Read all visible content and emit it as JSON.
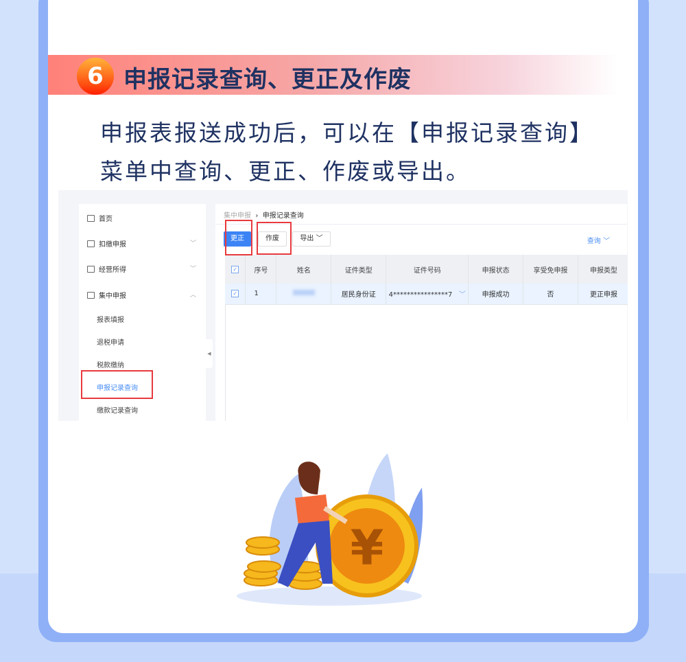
{
  "section": {
    "number": "6",
    "title": "申报记录查询、更正及作废",
    "description": "申报表报送成功后，可以在【申报记录查询】菜单中查询、更正、作废或导出。"
  },
  "sidebar": {
    "items": [
      {
        "label": "首页",
        "icon": "home-icon"
      },
      {
        "label": "扣缴申报",
        "icon": "form-icon"
      },
      {
        "label": "经营所得",
        "icon": "shirt-icon"
      },
      {
        "label": "集中申报",
        "icon": "monitor-icon",
        "expanded": true
      }
    ],
    "subitems": [
      "报表填报",
      "退税申请",
      "税款缴纳",
      "申报记录查询",
      "缴款记录查询"
    ],
    "active": "申报记录查询"
  },
  "breadcrumb": [
    "集中申报",
    "申报记录查询"
  ],
  "toolbar": {
    "correct": "更正",
    "void": "作废",
    "export": "导出",
    "query": "查询"
  },
  "table": {
    "columns": [
      "序号",
      "姓名",
      "证件类型",
      "证件号码",
      "申报状态",
      "享受免申报",
      "申报类型"
    ],
    "rows": [
      {
        "index": "1",
        "name": "",
        "id_type": "居民身份证",
        "id_number": "4****************7",
        "status": "申报成功",
        "exempt": "否",
        "type": "更正申报"
      }
    ]
  },
  "colors": {
    "accent": "#3c84f5",
    "highlight": "#e8393d",
    "title": "#1f3262"
  }
}
